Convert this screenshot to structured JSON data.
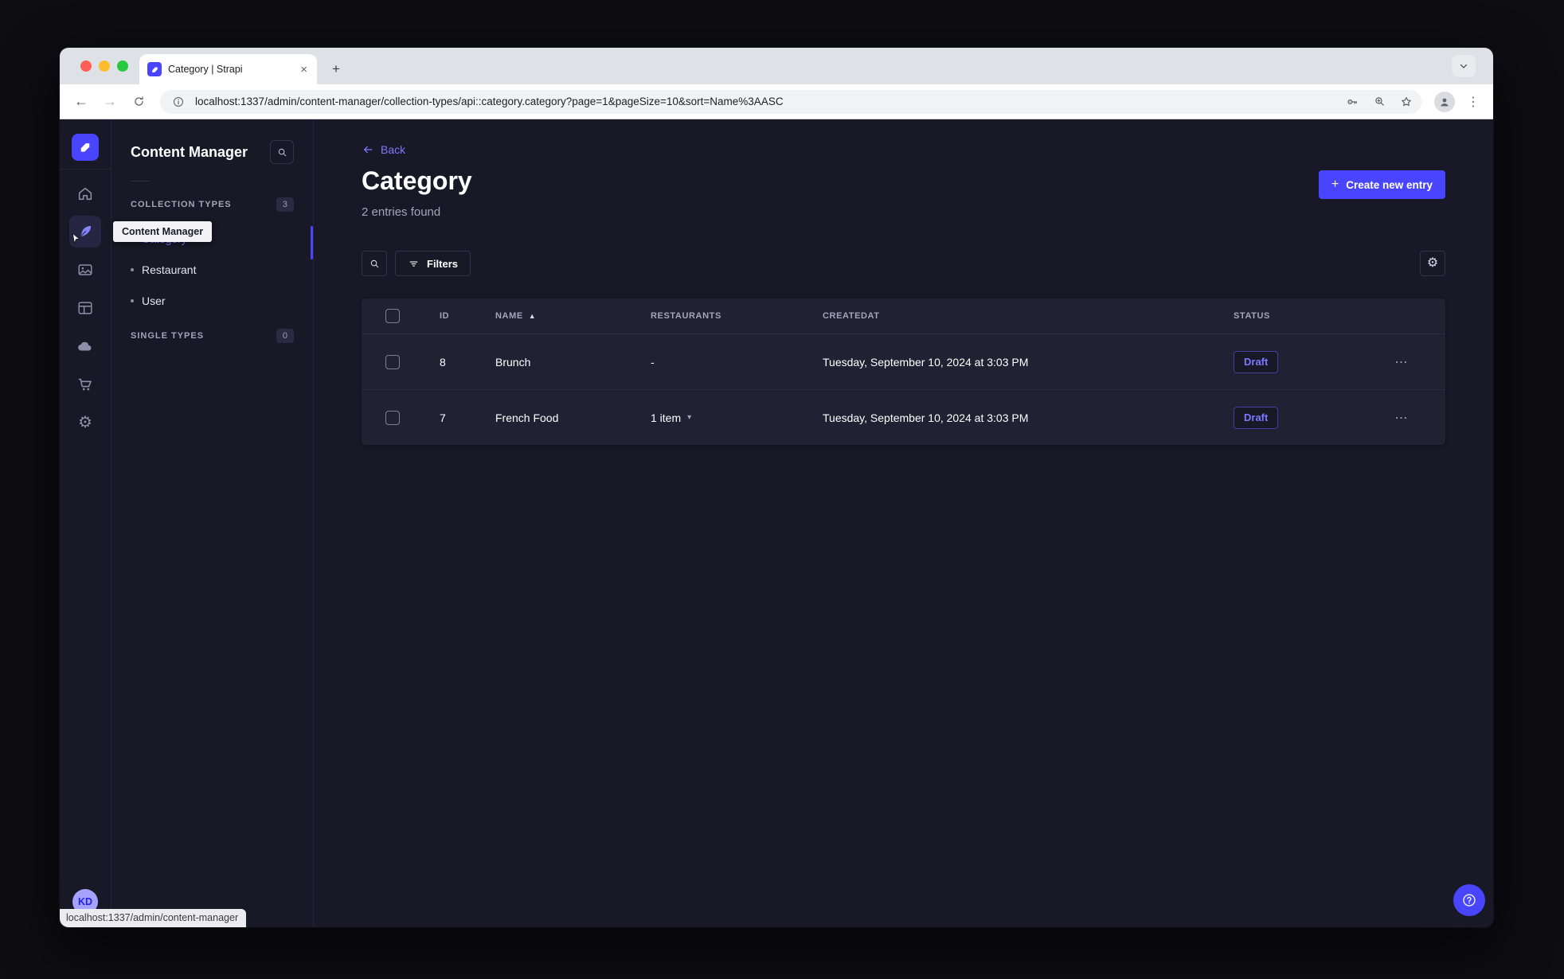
{
  "browser": {
    "tab_title": "Category | Strapi",
    "url": "localhost:1337/admin/content-manager/collection-types/api::category.category?page=1&pageSize=10&sort=Name%3AASC",
    "status_link": "localhost:1337/admin/content-manager",
    "traffic_lights": {
      "close": "#ff5f57",
      "minimize": "#febc2e",
      "zoom": "#28c840"
    }
  },
  "glyphs": {
    "close": "×",
    "plus": "+",
    "back_arrow": "←",
    "forward_arrow": "→",
    "menu_dots": "⋮",
    "row_dots": "⋯",
    "sort_asc": "▲",
    "caret_down": "▾",
    "gear": "⚙",
    "dash": "-"
  },
  "app": {
    "colors": {
      "primary": "#4945ff",
      "primary_light": "#7b79ff",
      "bg": "#181826",
      "surface": "#212134",
      "border": "#32324d",
      "text_muted": "#a5a5ba"
    },
    "nav": {
      "tooltip": "Content Manager",
      "avatar_initials": "KD",
      "items": [
        "home",
        "content-manager",
        "media-library",
        "content-type-builder",
        "cloud",
        "marketplace",
        "settings"
      ]
    },
    "subnav": {
      "title": "Content Manager",
      "sections": [
        {
          "label": "COLLECTION TYPES",
          "badge": "3",
          "items": [
            {
              "label": "Category",
              "active": true
            },
            {
              "label": "Restaurant",
              "active": false
            },
            {
              "label": "User",
              "active": false
            }
          ]
        },
        {
          "label": "SINGLE TYPES",
          "badge": "0",
          "items": []
        }
      ]
    },
    "main": {
      "back_label": "Back",
      "title": "Category",
      "subtitle": "2 entries found",
      "create_button": "Create new entry",
      "filters_button": "Filters"
    },
    "table": {
      "columns": [
        "ID",
        "NAME",
        "RESTAURANTS",
        "CREATEDAT",
        "STATUS"
      ],
      "sorted_by": "NAME",
      "rows": [
        {
          "id": "8",
          "name": "Brunch",
          "restaurants": "-",
          "has_dropdown": false,
          "createdAt": "Tuesday, September 10, 2024 at 3:03 PM",
          "status": "Draft"
        },
        {
          "id": "7",
          "name": "French Food",
          "restaurants": "1 item",
          "has_dropdown": true,
          "createdAt": "Tuesday, September 10, 2024 at 3:03 PM",
          "status": "Draft"
        }
      ]
    }
  }
}
